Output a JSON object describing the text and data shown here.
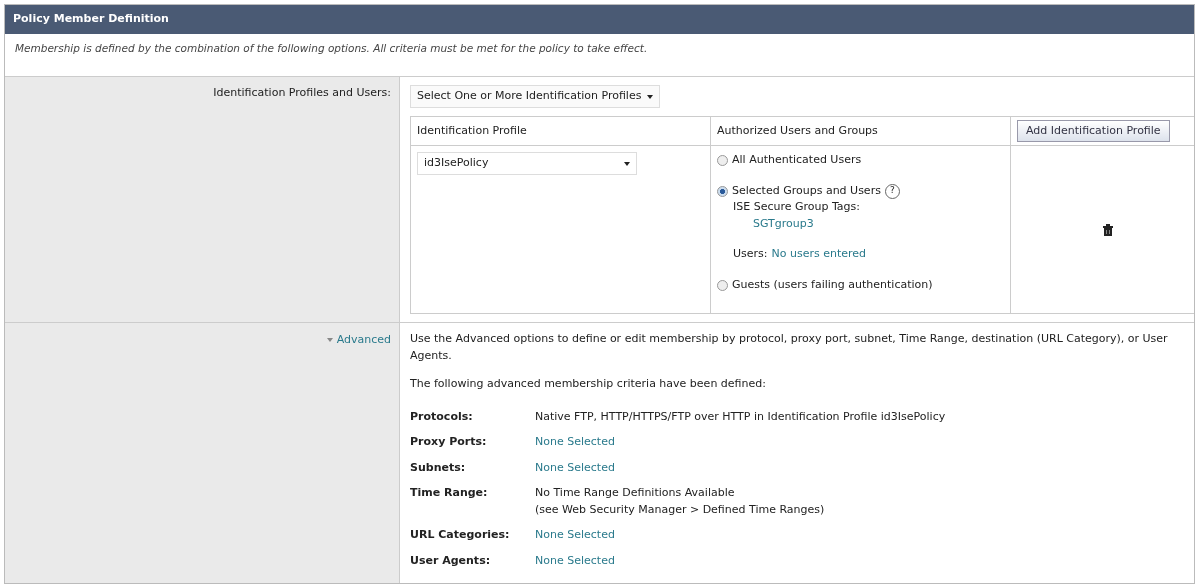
{
  "panel": {
    "title": "Policy Member Definition",
    "description": "Membership is defined by the combination of the following options. All criteria must be met for the policy to take effect."
  },
  "identification": {
    "label": "Identification Profiles and Users:",
    "selector": "Select One or More Identification Profiles",
    "columns": [
      "Identification Profile",
      "Authorized Users and Groups"
    ],
    "add_button": "Add Identification Profile",
    "profile": "id3IsePolicy",
    "options": [
      {
        "label": "All Authenticated Users",
        "selected": false
      },
      {
        "label": "Selected Groups and Users",
        "selected": true,
        "help": "?",
        "tags_label": "ISE Secure Group Tags:",
        "tags": [
          "SGTgroup3"
        ],
        "users_label": "Users:",
        "users_value": "No users entered"
      },
      {
        "label": "Guests (users failing authentication)",
        "selected": false
      }
    ]
  },
  "advanced": {
    "label": "Advanced",
    "expanded": true,
    "intro": "Use the Advanced options to define or edit membership by protocol, proxy port, subnet, Time Range, destination (URL Category), or User Agents.",
    "subtitle": "The following advanced membership criteria have been defined:",
    "criteria": [
      {
        "name": "Protocols:",
        "kind": "text",
        "lines": [
          "Native FTP, HTTP/HTTPS/FTP over HTTP in Identification Profile id3IsePolicy"
        ]
      },
      {
        "name": "Proxy Ports:",
        "kind": "link",
        "lines": [
          "None Selected"
        ]
      },
      {
        "name": "Subnets:",
        "kind": "link",
        "lines": [
          "None Selected"
        ]
      },
      {
        "name": "Time Range:",
        "kind": "text",
        "lines": [
          "No Time Range Definitions Available",
          "(see Web Security Manager > Defined Time Ranges)"
        ]
      },
      {
        "name": "URL Categories:",
        "kind": "link",
        "lines": [
          "None Selected"
        ]
      },
      {
        "name": "User Agents:",
        "kind": "link",
        "lines": [
          "None Selected"
        ]
      }
    ]
  }
}
